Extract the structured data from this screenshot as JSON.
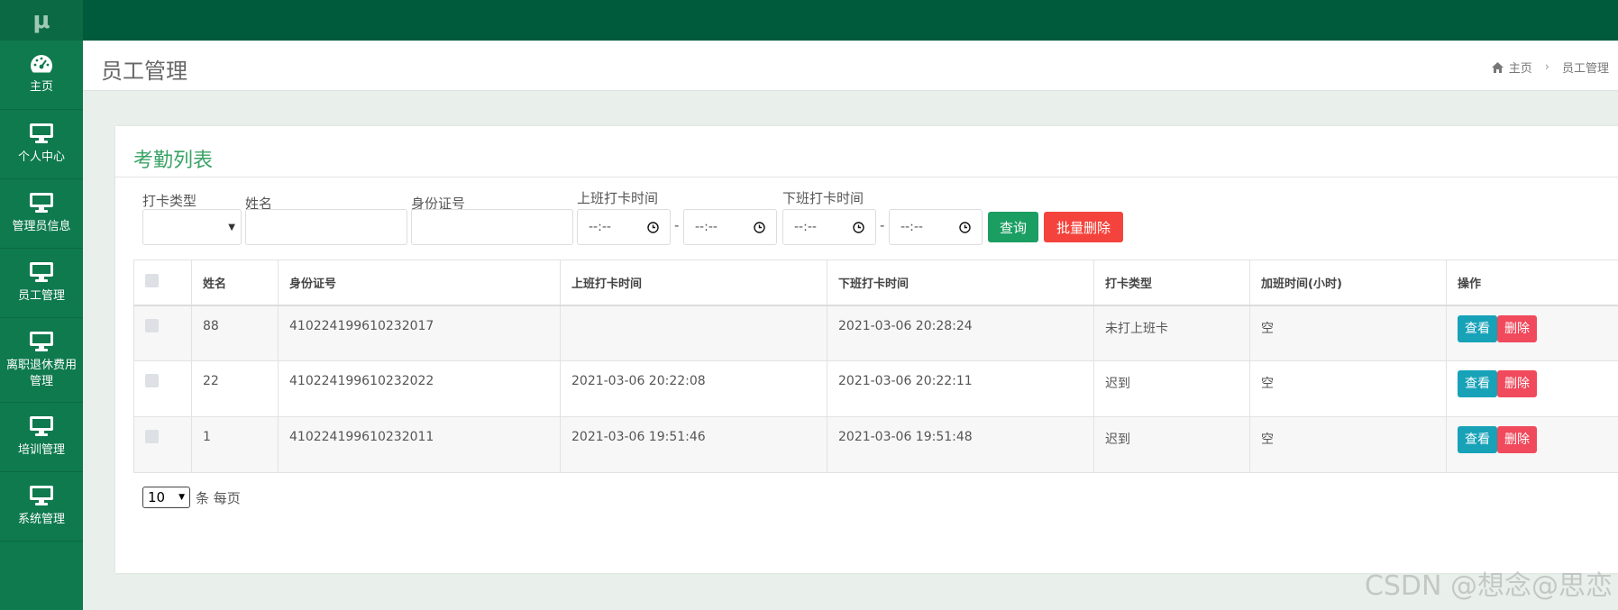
{
  "app": {
    "logo": "μ"
  },
  "sidebar": {
    "items": [
      {
        "label": "主页",
        "icon": "dashboard-icon"
      },
      {
        "label": "个人中心",
        "icon": "monitor-icon"
      },
      {
        "label": "管理员信息",
        "icon": "monitor-icon"
      },
      {
        "label": "员工管理",
        "icon": "monitor-icon"
      },
      {
        "label": "离职退休费用管理",
        "icon": "monitor-icon"
      },
      {
        "label": "培训管理",
        "icon": "monitor-icon"
      },
      {
        "label": "系统管理",
        "icon": "monitor-icon"
      }
    ]
  },
  "header": {
    "title": "员工管理",
    "breadcrumb": {
      "home": "主页",
      "current": "员工管理"
    }
  },
  "card": {
    "title": "考勤列表"
  },
  "filters": {
    "punch_type_label": "打卡类型",
    "name_label": "姓名",
    "id_label": "身份证号",
    "on_time_label": "上班打卡时间",
    "off_time_label": "下班打卡时间",
    "time_placeholder": "--:--",
    "dash": "-",
    "query_button": "查询",
    "batch_delete_button": "批量删除"
  },
  "table": {
    "headers": [
      "姓名",
      "身份证号",
      "上班打卡时间",
      "下班打卡时间",
      "打卡类型",
      "加班时间(小时)",
      "操作"
    ],
    "rows": [
      {
        "name": "88",
        "id": "410224199610232017",
        "on_time": "",
        "off_time": "2021-03-06 20:28:24",
        "type": "未打上班卡",
        "overtime": "空"
      },
      {
        "name": "22",
        "id": "410224199610232022",
        "on_time": "2021-03-06 20:22:08",
        "off_time": "2021-03-06 20:22:11",
        "type": "迟到",
        "overtime": "空"
      },
      {
        "name": "1",
        "id": "410224199610232011",
        "on_time": "2021-03-06 19:51:46",
        "off_time": "2021-03-06 19:51:48",
        "type": "迟到",
        "overtime": "空"
      }
    ],
    "view_button": "查看",
    "delete_button": "删除"
  },
  "pager": {
    "page_size": "10",
    "suffix": "条 每页"
  },
  "watermark": "CSDN @想念@思恋",
  "colors": {
    "sidebar": "#0e7a4e",
    "topbar": "#005a3c",
    "accent_title": "#3aa366",
    "query": "#1a9e62",
    "danger": "#f4433c",
    "view": "#17a2b8"
  }
}
